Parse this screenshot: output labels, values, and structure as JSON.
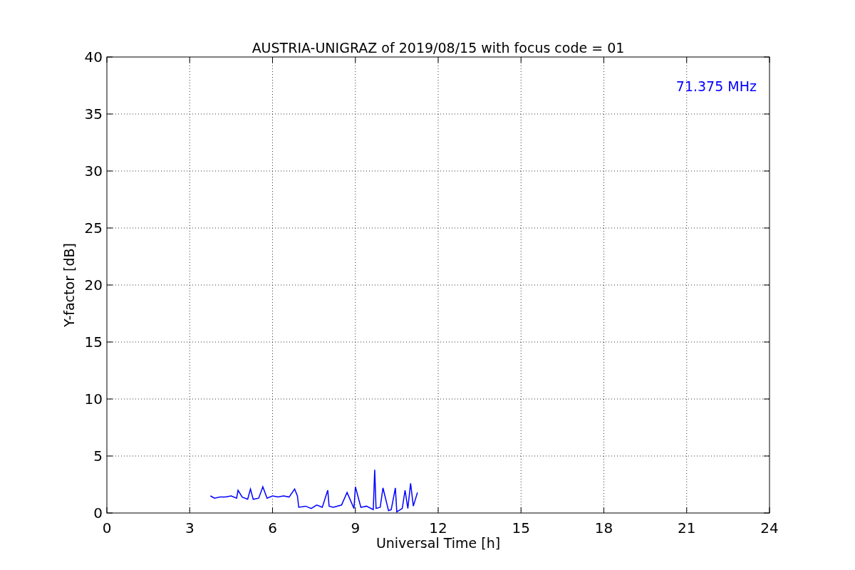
{
  "figure": {
    "chart_data": {
      "type": "line",
      "title": "AUSTRIA-UNIGRAZ of 2019/08/15 with focus code = 01",
      "xlabel": "Universal Time [h]",
      "ylabel": "Y-factor [dB]",
      "xlim": [
        0,
        24
      ],
      "ylim": [
        0,
        40
      ],
      "xticks": [
        0,
        3,
        6,
        9,
        12,
        15,
        18,
        21,
        24
      ],
      "yticks": [
        0,
        5,
        10,
        15,
        20,
        25,
        30,
        35,
        40
      ],
      "x": [
        3.75,
        3.9,
        4.1,
        4.3,
        4.5,
        4.7,
        4.75,
        4.9,
        5.1,
        5.2,
        5.3,
        5.5,
        5.65,
        5.8,
        6.0,
        6.2,
        6.4,
        6.6,
        6.8,
        6.9,
        6.95,
        7.2,
        7.4,
        7.6,
        7.8,
        8.0,
        8.05,
        8.2,
        8.5,
        8.7,
        8.95,
        9.0,
        9.2,
        9.4,
        9.65,
        9.7,
        9.75,
        9.9,
        10.0,
        10.2,
        10.3,
        10.45,
        10.5,
        10.7,
        10.8,
        10.9,
        11.0,
        11.1,
        11.25
      ],
      "series": [
        {
          "name": "71.375 MHz",
          "color": "#0000ff",
          "values": [
            1.5,
            1.3,
            1.4,
            1.4,
            1.5,
            1.3,
            2.0,
            1.4,
            1.2,
            2.1,
            1.2,
            1.3,
            2.3,
            1.3,
            1.5,
            1.4,
            1.5,
            1.4,
            2.1,
            1.5,
            0.5,
            0.6,
            0.4,
            0.7,
            0.5,
            2.0,
            0.6,
            0.5,
            0.7,
            1.8,
            0.4,
            2.3,
            0.5,
            0.6,
            0.3,
            3.8,
            0.4,
            0.5,
            2.2,
            0.2,
            0.3,
            2.2,
            0.1,
            0.4,
            2.0,
            0.4,
            2.6,
            0.6,
            1.8
          ]
        }
      ],
      "grid": true
    }
  }
}
